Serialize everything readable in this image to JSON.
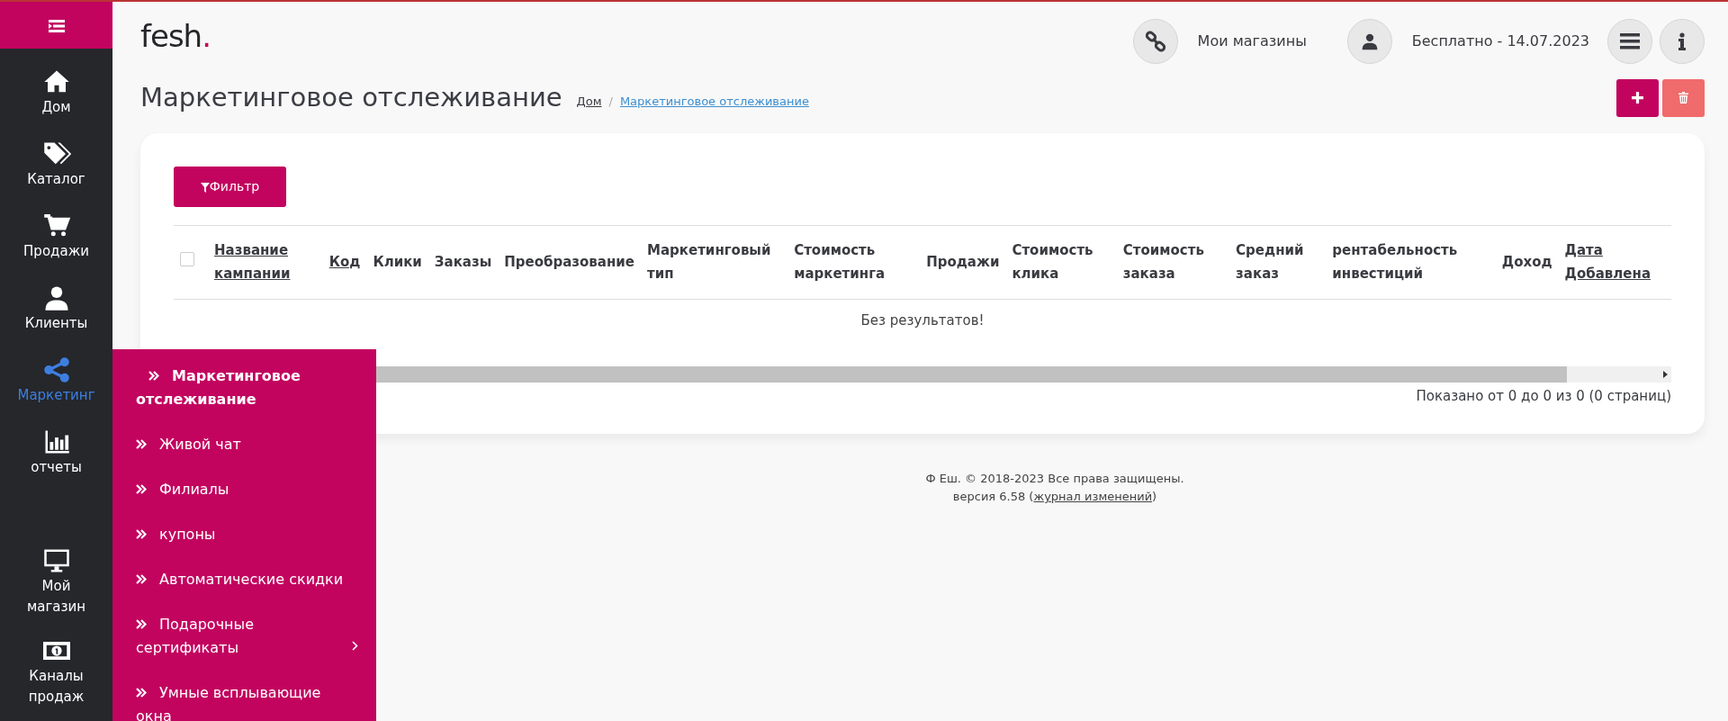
{
  "sidebar": {
    "items": [
      {
        "label": "Дом",
        "selected": false
      },
      {
        "label": "Каталог",
        "selected": false
      },
      {
        "label": "Продажи",
        "selected": false
      },
      {
        "label": "Клиенты",
        "selected": false
      },
      {
        "label": "Маркетинг",
        "selected": true
      },
      {
        "label": "отчеты",
        "selected": false
      },
      {
        "label": "Мой магазин",
        "selected": false
      },
      {
        "label": "Каналы продаж",
        "selected": false
      }
    ]
  },
  "submenu": {
    "items": [
      {
        "label": "Маркетинговое отслеживание",
        "selected": true,
        "has_children": false
      },
      {
        "label": "Живой чат",
        "selected": false,
        "has_children": false
      },
      {
        "label": "Филиалы",
        "selected": false,
        "has_children": false
      },
      {
        "label": "купоны",
        "selected": false,
        "has_children": false
      },
      {
        "label": "Автоматические скидки",
        "selected": false,
        "has_children": false
      },
      {
        "label": "Подарочные сертификаты",
        "selected": false,
        "has_children": true
      },
      {
        "label": "Умные всплывающие окна",
        "selected": false,
        "has_children": false
      }
    ]
  },
  "logo": {
    "text": "fesh",
    "accent": "."
  },
  "header": {
    "shops_link": "Мои магазины",
    "plan": "Бесплатно - 14.07.2023"
  },
  "page_title": "Маркетинговое отслеживание",
  "breadcrumb_separator": "/",
  "breadcrumb": [
    {
      "label": "Дом",
      "current": false
    },
    {
      "label": "Маркетинговое отслеживание",
      "current": true
    }
  ],
  "filter_button": "Фильтр",
  "table": {
    "select_all": {
      "checked": false
    },
    "columns": [
      {
        "label": "Название кампании",
        "sortable": true
      },
      {
        "label": "Код",
        "sortable": true
      },
      {
        "label": "Клики",
        "sortable": false
      },
      {
        "label": "Заказы",
        "sortable": false
      },
      {
        "label": "Преобразование",
        "sortable": false
      },
      {
        "label": "Маркетинговый тип",
        "sortable": false
      },
      {
        "label": "Стоимость маркетинга",
        "sortable": false
      },
      {
        "label": "Продажи",
        "sortable": false
      },
      {
        "label": "Стоимость клика",
        "sortable": false
      },
      {
        "label": "Стоимость заказа",
        "sortable": false
      },
      {
        "label": "Средний заказ",
        "sortable": false
      },
      {
        "label": "рентабельность инвестиций",
        "sortable": false
      },
      {
        "label": "Доход",
        "sortable": false
      },
      {
        "label": "Дата Добавлена",
        "sortable": true
      }
    ],
    "empty_message": "Без результатов!"
  },
  "pagination_info": "Показано от 0 до 0 из 0 (0 страниц)",
  "footer": {
    "copyright": "Ф Еш. © 2018-2023 Все права защищены.",
    "version_prefix": "версия 6.58 (",
    "changelog_link": "журнал изменений",
    "version_suffix": ")"
  }
}
